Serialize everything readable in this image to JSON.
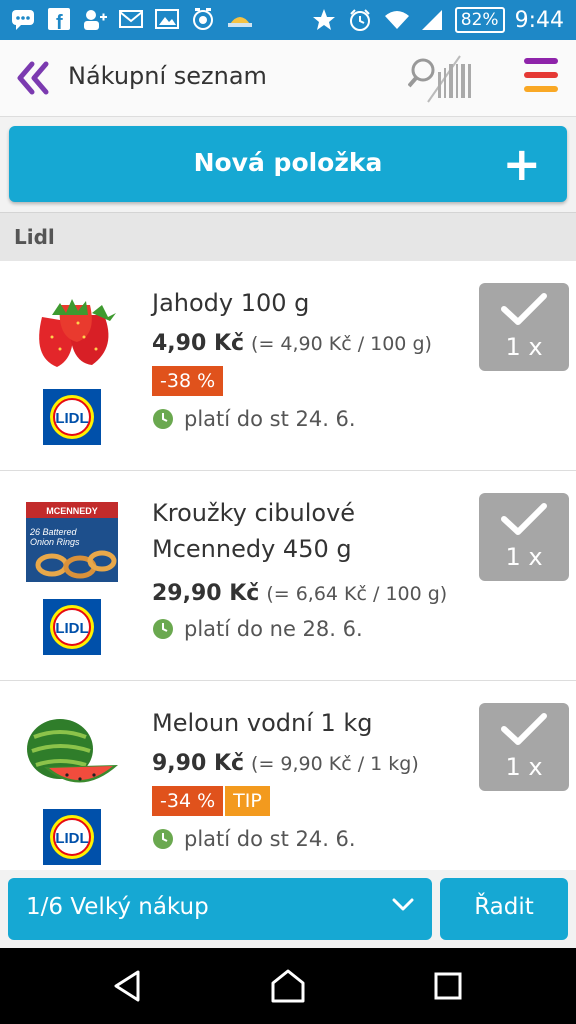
{
  "status_bar": {
    "left_icons": [
      "chat-icon",
      "facebook-icon",
      "add-user-icon",
      "gmail-icon",
      "gallery-icon",
      "alarm-app-icon",
      "weather-icon"
    ],
    "right_icons": [
      "star-icon",
      "alarm-icon",
      "wifi-icon",
      "signal-icon"
    ],
    "battery": "82%",
    "time": "9:44"
  },
  "app_bar": {
    "title": "Nákupní seznam",
    "back_icon": "double-chevron-left-icon",
    "scan_icon": "barcode-search-icon",
    "menu_icon": "menu-icon",
    "menu_colors": [
      "#8e24aa",
      "#e53935",
      "#f9a825"
    ]
  },
  "new_item_button": {
    "label": "Nová položka",
    "plus": "+"
  },
  "section": {
    "label": "Lidl"
  },
  "items": [
    {
      "name": "Jahody 100 g",
      "price": "4,90 Kč",
      "unit_price": "(= 4,90 Kč / 100 g)",
      "badges": [
        {
          "text": "-38 %",
          "color": "#e0521c"
        }
      ],
      "valid": "platí do st 24. 6.",
      "qty": "1 x",
      "logo": "LIDL"
    },
    {
      "name": "Kroužky cibulové Mcennedy 450 g",
      "price": "29,90 Kč",
      "unit_price": "(= 6,64 Kč / 100 g)",
      "badges": [],
      "valid": "platí do ne 28. 6.",
      "qty": "1 x",
      "logo": "LIDL",
      "package_text": [
        "MCENNEDY",
        "26 Battered",
        "Onion Rings"
      ]
    },
    {
      "name": "Meloun vodní 1 kg",
      "price": "9,90 Kč",
      "unit_price": "(= 9,90 Kč / 1 kg)",
      "badges": [
        {
          "text": "-34 %",
          "color": "#e0521c"
        },
        {
          "text": "TIP",
          "color": "#f39a1e"
        }
      ],
      "valid": "platí do st 24. 6.",
      "qty": "1 x",
      "logo": "LIDL"
    }
  ],
  "bottom_bar": {
    "list_selector": "1/6 Velký nákup",
    "sort_button": "Řadit"
  },
  "colors": {
    "accent": "#16a8d3",
    "status_bar": "#1e88c7",
    "discount": "#e0521c",
    "tip": "#f39a1e",
    "valid_icon": "#6aa84f",
    "check_bg": "#a6a6a6"
  }
}
